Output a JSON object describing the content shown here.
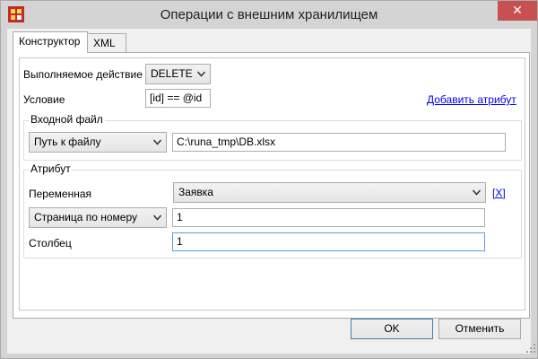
{
  "window": {
    "title": "Операции с внешним хранилищем",
    "close_glyph": "✕"
  },
  "tabs": [
    {
      "label": "Конструктор",
      "active": true
    },
    {
      "label": "XML",
      "active": false
    }
  ],
  "form": {
    "action_label": "Выполняемое действие",
    "action_value": "DELETE",
    "condition_label": "Условие",
    "condition_value": "[id] == @id",
    "add_attribute_link": "Добавить атрибут",
    "input_file_group": "Входной файл",
    "path_select": "Путь к файлу",
    "path_value": "C:\\runa_tmp\\DB.xlsx",
    "attribute_group": "Атрибут",
    "variable_label": "Переменная",
    "variable_value": "Заявка",
    "remove_link": "[X]",
    "page_select": "Страница по номеру",
    "page_value": "1",
    "column_label": "Столбец",
    "column_value": "1"
  },
  "buttons": {
    "ok": "OK",
    "cancel": "Отменить"
  },
  "icons": [
    "app-icon",
    "close-icon",
    "chevron-down-icon",
    "resize-grip-icon"
  ],
  "colors": {
    "close_button": "#c75050",
    "link": "#0000ee",
    "focus_border": "#569de5"
  }
}
